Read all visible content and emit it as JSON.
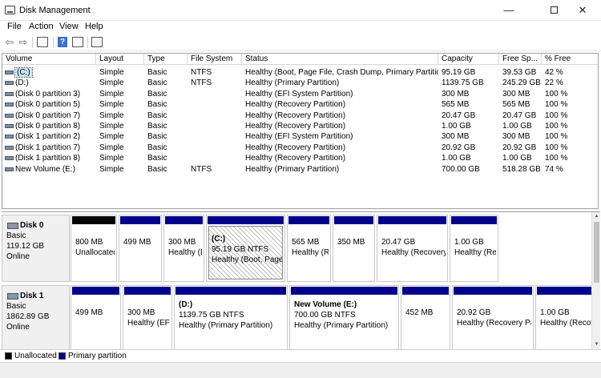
{
  "window": {
    "title": "Disk Management",
    "minimize": "—",
    "close": "✕"
  },
  "menu": [
    "File",
    "Action",
    "View",
    "Help"
  ],
  "toolbar": {
    "back": "⇦",
    "forward": "⇨",
    "help": "?"
  },
  "list": {
    "columns": [
      "Volume",
      "Layout",
      "Type",
      "File System",
      "Status",
      "Capacity",
      "Free Sp...",
      "% Free"
    ],
    "rows": [
      [
        "(C:)",
        "Simple",
        "Basic",
        "NTFS",
        "Healthy (Boot, Page File, Crash Dump, Primary Partition)",
        "95.19 GB",
        "39.53 GB",
        "42 %"
      ],
      [
        "(D:)",
        "Simple",
        "Basic",
        "NTFS",
        "Healthy (Primary Partition)",
        "1139.75 GB",
        "245.29 GB",
        "22 %"
      ],
      [
        "(Disk 0 partition 3)",
        "Simple",
        "Basic",
        "",
        "Healthy (EFI System Partition)",
        "300 MB",
        "300 MB",
        "100 %"
      ],
      [
        "(Disk 0 partition 5)",
        "Simple",
        "Basic",
        "",
        "Healthy (Recovery Partition)",
        "565 MB",
        "565 MB",
        "100 %"
      ],
      [
        "(Disk 0 partition 7)",
        "Simple",
        "Basic",
        "",
        "Healthy (Recovery Partition)",
        "20.47 GB",
        "20.47 GB",
        "100 %"
      ],
      [
        "(Disk 0 partition 8)",
        "Simple",
        "Basic",
        "",
        "Healthy (Recovery Partition)",
        "1.00 GB",
        "1.00 GB",
        "100 %"
      ],
      [
        "(Disk 1 partition 2)",
        "Simple",
        "Basic",
        "",
        "Healthy (EFI System Partition)",
        "300 MB",
        "300 MB",
        "100 %"
      ],
      [
        "(Disk 1 partition 7)",
        "Simple",
        "Basic",
        "",
        "Healthy (Recovery Partition)",
        "20.92 GB",
        "20.92 GB",
        "100 %"
      ],
      [
        "(Disk 1 partition 8)",
        "Simple",
        "Basic",
        "",
        "Healthy (Recovery Partition)",
        "1.00 GB",
        "1.00 GB",
        "100 %"
      ],
      [
        "New Volume (E:)",
        "Simple",
        "Basic",
        "NTFS",
        "Healthy (Primary Partition)",
        "700.00 GB",
        "518.28 GB",
        "74 %"
      ]
    ]
  },
  "disks": [
    {
      "name": "Disk 0",
      "type": "Basic",
      "size": "119.12 GB",
      "state": "Online",
      "partitions": [
        {
          "name": "",
          "line1": "800 MB",
          "line2": "Unallocated",
          "kind": "unallocated"
        },
        {
          "name": "",
          "line1": "499 MB",
          "line2": "",
          "kind": "primary"
        },
        {
          "name": "",
          "line1": "300 MB",
          "line2": "Healthy (EFI System Partition)",
          "kind": "primary"
        },
        {
          "name": "(C:)",
          "line1": "95.19 GB NTFS",
          "line2": "Healthy (Boot, Page File, Crash Dump, Primary Partition)",
          "kind": "primary",
          "selected": true
        },
        {
          "name": "",
          "line1": "565 MB",
          "line2": "Healthy (Recovery Partition)",
          "kind": "primary"
        },
        {
          "name": "",
          "line1": "350 MB",
          "line2": "",
          "kind": "primary"
        },
        {
          "name": "",
          "line1": "20.47 GB",
          "line2": "Healthy (Recovery Partition)",
          "kind": "primary"
        },
        {
          "name": "",
          "line1": "1.00 GB",
          "line2": "Healthy (Recovery Partition)",
          "kind": "primary"
        }
      ]
    },
    {
      "name": "Disk 1",
      "type": "Basic",
      "size": "1862.89 GB",
      "state": "Online",
      "partitions": [
        {
          "name": "",
          "line1": "499 MB",
          "line2": "",
          "kind": "primary"
        },
        {
          "name": "",
          "line1": "300 MB",
          "line2": "Healthy (EFI System Partition)",
          "kind": "primary"
        },
        {
          "name": "(D:)",
          "line1": "1139.75 GB NTFS",
          "line2": "Healthy (Primary Partition)",
          "kind": "primary"
        },
        {
          "name": "New Volume  (E:)",
          "line1": "700.00 GB NTFS",
          "line2": "Healthy (Primary Partition)",
          "kind": "primary"
        },
        {
          "name": "",
          "line1": "452 MB",
          "line2": "",
          "kind": "primary"
        },
        {
          "name": "",
          "line1": "20.92 GB",
          "line2": "Healthy (Recovery Partition)",
          "kind": "primary"
        },
        {
          "name": "",
          "line1": "1.00 GB",
          "line2": "Healthy (Recovery Partition)",
          "kind": "primary"
        }
      ]
    }
  ],
  "legend": [
    {
      "label": "Unallocated",
      "color": "#000000"
    },
    {
      "label": "Primary partition",
      "color": "#00008b"
    }
  ]
}
